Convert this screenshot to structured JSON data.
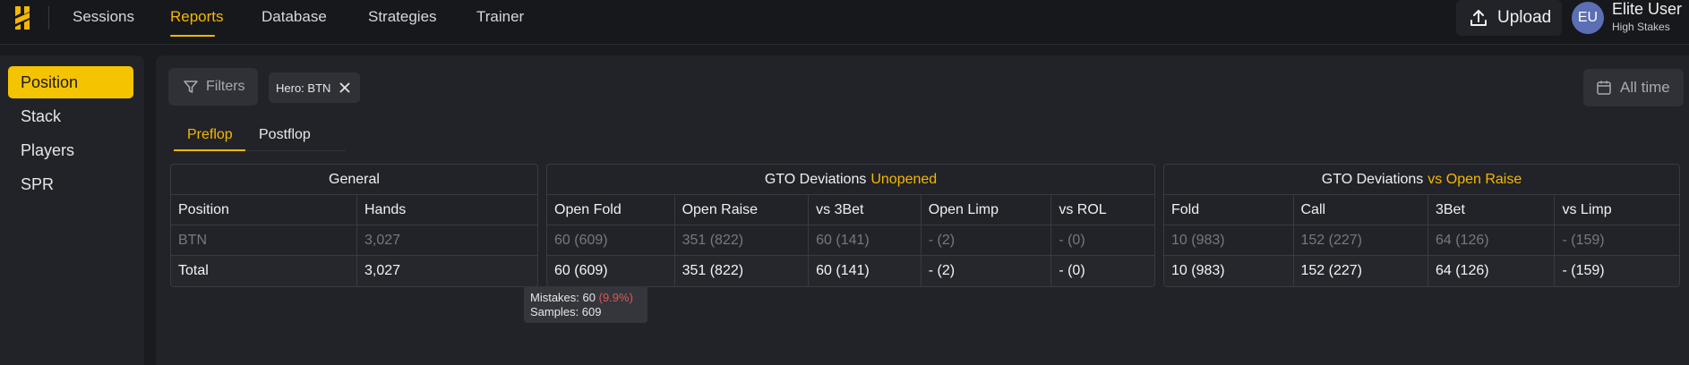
{
  "nav": {
    "items": [
      "Sessions",
      "Reports",
      "Database",
      "Strategies",
      "Trainer"
    ],
    "active": "Reports",
    "upload_label": "Upload",
    "user": {
      "initials": "EU",
      "name": "Elite User",
      "tier": "High Stakes"
    }
  },
  "sidebar": {
    "items": [
      "Position",
      "Stack",
      "Players",
      "SPR"
    ],
    "active": "Position"
  },
  "toolbar": {
    "filters_label": "Filters",
    "chip_label": "Hero: BTN",
    "date_label": "All time"
  },
  "tabs": {
    "items": [
      "Preflop",
      "Postflop"
    ],
    "active": "Preflop"
  },
  "tables": {
    "general": {
      "title": "General",
      "columns": [
        "Position",
        "Hands"
      ],
      "rows": [
        [
          "BTN",
          "3,027"
        ],
        [
          "Total",
          "3,027"
        ]
      ]
    },
    "unopened": {
      "title": "GTO Deviations",
      "title_accent": "Unopened",
      "columns": [
        "Open Fold",
        "Open Raise",
        "vs 3Bet",
        "Open Limp",
        "vs ROL"
      ],
      "rows": [
        [
          "60 (609)",
          "351 (822)",
          "60 (141)",
          "- (2)",
          "- (0)"
        ],
        [
          "60 (609)",
          "351 (822)",
          "60 (141)",
          "- (2)",
          "- (0)"
        ]
      ]
    },
    "vs_open": {
      "title": "GTO Deviations",
      "title_accent": "vs Open Raise",
      "columns": [
        "Fold",
        "Call",
        "3Bet",
        "vs Limp"
      ],
      "rows": [
        [
          "10 (983)",
          "152 (227)",
          "64 (126)",
          "- (159)"
        ],
        [
          "10 (983)",
          "152 (227)",
          "64 (126)",
          "- (159)"
        ]
      ]
    }
  },
  "tooltip": {
    "mistakes_label": "Mistakes: 60",
    "mistakes_pct": "(9.9%)",
    "samples_label": "Samples: 609"
  },
  "colors": {
    "accent": "#f5b800",
    "active_side": "#f5c400",
    "danger": "#e05555",
    "avatar": "#5b6fb5"
  }
}
